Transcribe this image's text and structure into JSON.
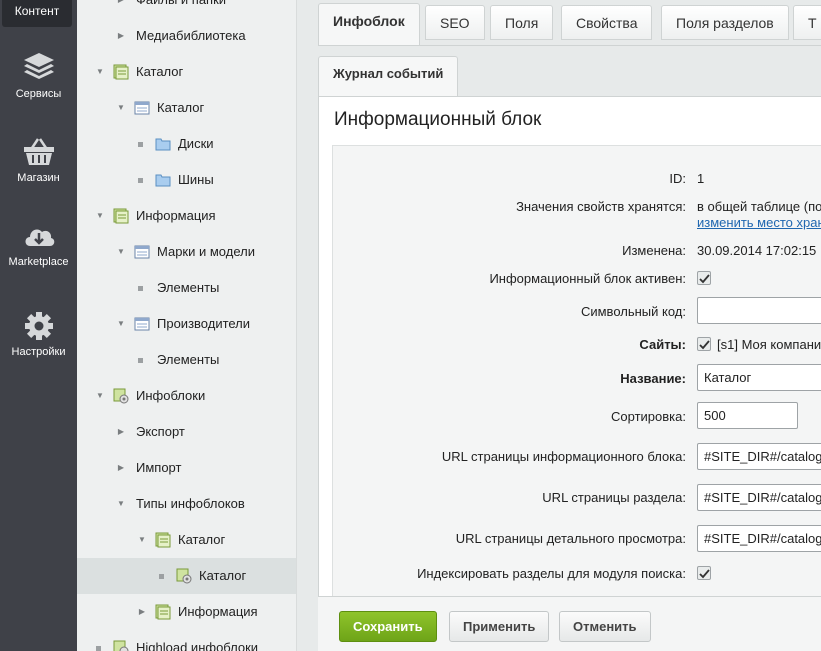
{
  "leftbar": {
    "top_label": "Контент",
    "items": [
      {
        "label": "Сервисы",
        "icon": "layers-icon"
      },
      {
        "label": "Магазин",
        "icon": "basket-icon"
      },
      {
        "label": "Marketplace",
        "icon": "cloud-download-icon"
      },
      {
        "label": "Настройки",
        "icon": "gear-icon"
      }
    ]
  },
  "tree": {
    "items": [
      {
        "label": "Файлы и папки"
      },
      {
        "label": "Медиабиблиотека"
      },
      {
        "label": "Каталог"
      },
      {
        "label": "Каталог"
      },
      {
        "label": "Диски"
      },
      {
        "label": "Шины"
      },
      {
        "label": "Информация"
      },
      {
        "label": "Марки и модели"
      },
      {
        "label": "Элементы"
      },
      {
        "label": "Производители"
      },
      {
        "label": "Элементы"
      },
      {
        "label": "Инфоблоки"
      },
      {
        "label": "Экспорт"
      },
      {
        "label": "Импорт"
      },
      {
        "label": "Типы инфоблоков"
      },
      {
        "label": "Каталог"
      },
      {
        "label": "Каталог"
      },
      {
        "label": "Информация"
      },
      {
        "label": "Highload инфоблоки"
      }
    ]
  },
  "tabs": [
    "Инфоблок",
    "SEO",
    "Поля",
    "Свойства",
    "Поля разделов",
    "T"
  ],
  "tab_row2": [
    "Журнал событий"
  ],
  "panel": {
    "title": "Информационный блок",
    "fields": {
      "id_label": "ID:",
      "id_value": "1",
      "storage_label": "Значения свойств хранятся:",
      "storage_value": "в общей таблице (по",
      "storage_link": "изменить место хран",
      "modified_label": "Изменена:",
      "modified_value": "30.09.2014 17:02:15",
      "active_label": "Информационный блок активен:",
      "code_label": "Символьный код:",
      "code_value": "",
      "sites_label": "Сайты:",
      "sites_value": "[s1] Моя компани",
      "name_label": "Название:",
      "name_value": "Каталог",
      "sort_label": "Сортировка:",
      "sort_value": "500",
      "list_url_label": "URL страницы информационного блока:",
      "list_url_value": "#SITE_DIR#/catalog/",
      "section_url_label": "URL страницы раздела:",
      "section_url_value": "#SITE_DIR#/catalog/",
      "detail_url_label": "URL страницы детального просмотра:",
      "detail_url_value": "#SITE_DIR#/catalog/",
      "index_label": "Индексировать разделы для модуля поиска:"
    }
  },
  "footer": {
    "save": "Сохранить",
    "apply": "Применить",
    "cancel": "Отменить"
  }
}
